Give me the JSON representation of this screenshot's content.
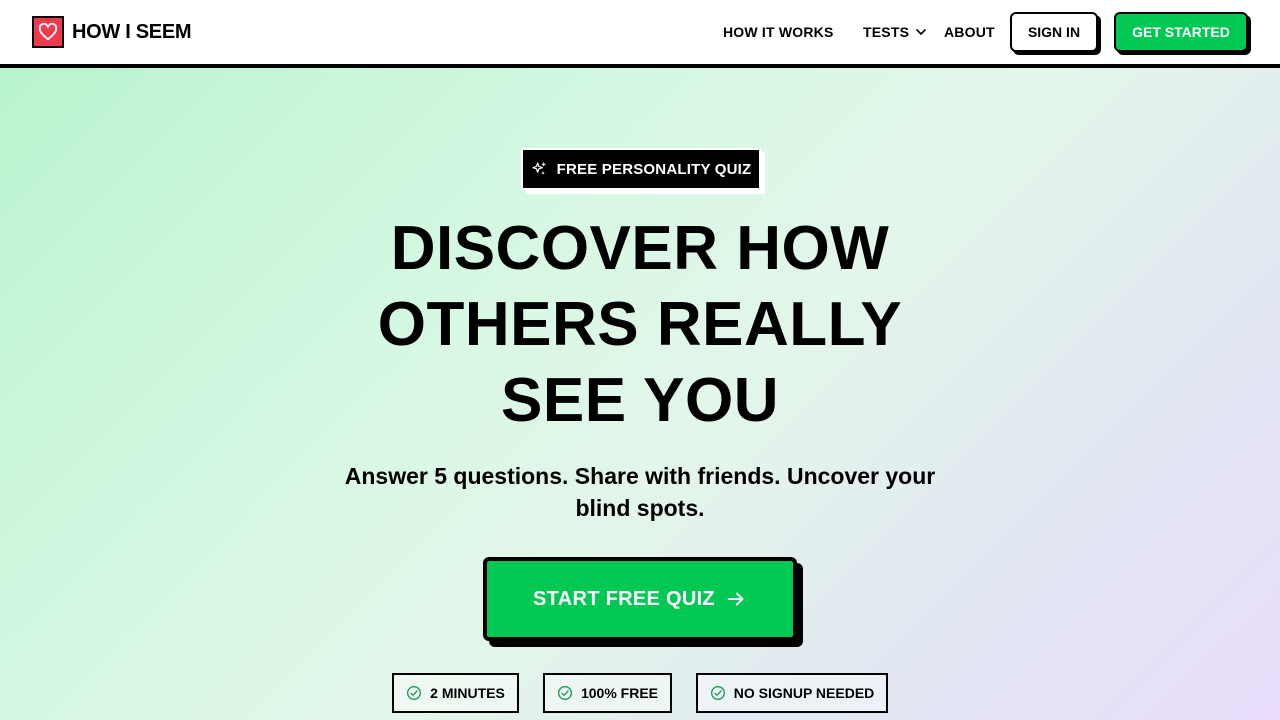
{
  "header": {
    "brand": "HOW I SEEM",
    "nav": {
      "how_it_works": "HOW IT WORKS",
      "tests": "TESTS",
      "about": "ABOUT"
    },
    "sign_in": "SIGN IN",
    "get_started": "GET STARTED"
  },
  "hero": {
    "badge": "FREE PERSONALITY QUIZ",
    "headline": [
      "DISCOVER HOW",
      "OTHERS REALLY",
      "SEE YOU"
    ],
    "subhead": "Answer 5 questions. Share with friends. Uncover your blind spots.",
    "cta": "START FREE QUIZ",
    "features": [
      "2 MINUTES",
      "100% FREE",
      "NO SIGNUP NEEDED"
    ]
  },
  "colors": {
    "accent_green": "#00c853",
    "logo_red": "#ef3b4d",
    "check_green": "#1a9a52"
  },
  "icons": {
    "logo": "heart-icon",
    "tests_dropdown": "chevron-down-icon",
    "badge": "sparkles-icon",
    "cta": "arrow-right-icon",
    "feature": "check-circle-icon"
  }
}
